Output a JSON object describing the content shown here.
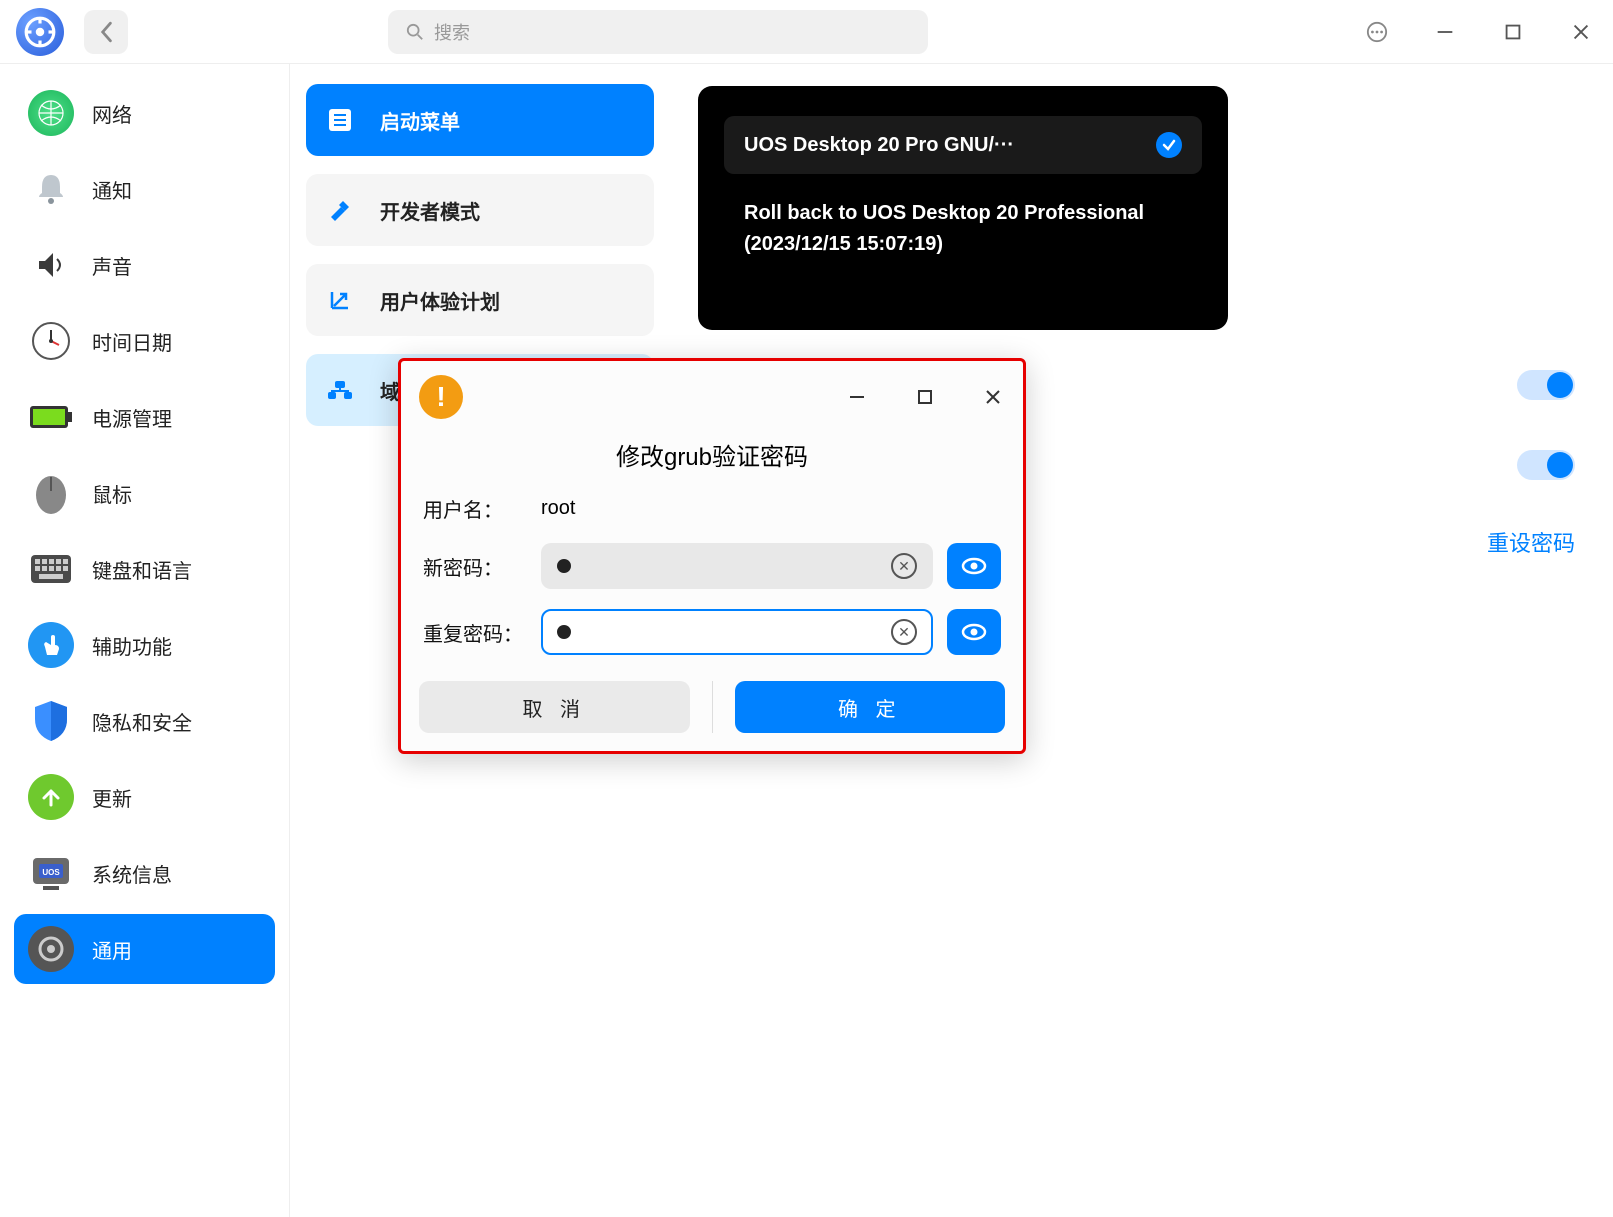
{
  "header": {
    "search_placeholder": "搜索"
  },
  "sidebar": {
    "items": [
      {
        "label": "网络"
      },
      {
        "label": "通知"
      },
      {
        "label": "声音"
      },
      {
        "label": "时间日期"
      },
      {
        "label": "电源管理"
      },
      {
        "label": "鼠标"
      },
      {
        "label": "键盘和语言"
      },
      {
        "label": "辅助功能"
      },
      {
        "label": "隐私和安全"
      },
      {
        "label": "更新"
      },
      {
        "label": "系统信息"
      },
      {
        "label": "通用"
      }
    ]
  },
  "sections": {
    "items": [
      {
        "label": "启动菜单"
      },
      {
        "label": "开发者模式"
      },
      {
        "label": "用户体验计划"
      },
      {
        "label": "域"
      }
    ]
  },
  "grub": {
    "entry1": "UOS Desktop 20 Pro GNU/···",
    "entry2": "Roll back to UOS Desktop 20 Professional (2023/12/15 15:07:19)"
  },
  "reset_password_link": "重设密码",
  "modal": {
    "title": "修改grub验证密码",
    "username_label": "用户名：",
    "username_value": "root",
    "newpw_label": "新密码：",
    "repeatpw_label": "重复密码：",
    "cancel": "取 消",
    "ok": "确 定"
  }
}
